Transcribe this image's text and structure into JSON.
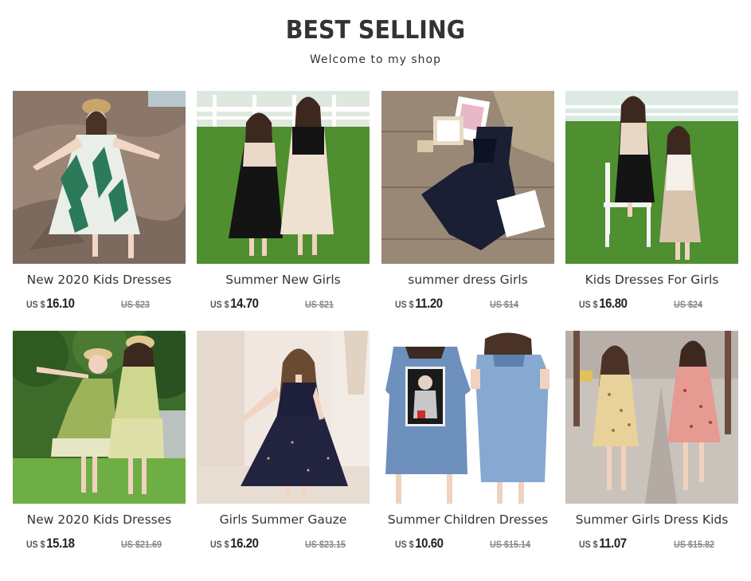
{
  "header": {
    "title": "BEST SELLING",
    "subtitle": "Welcome to my shop"
  },
  "products": [
    {
      "name": "New 2020 Kids Dresses",
      "currency": "US $",
      "price": "16.10",
      "old_price": "US $23",
      "image": "girl-leaf-print-dress-on-rocks"
    },
    {
      "name": "Summer New Girls",
      "currency": "US $",
      "price": "14.70",
      "old_price": "US $21",
      "image": "two-girls-black-and-beige-dresses"
    },
    {
      "name": "summer dress Girls",
      "currency": "US $",
      "price": "11.20",
      "old_price": "US $14",
      "image": "navy-pleated-dress-flatlay"
    },
    {
      "name": "Kids Dresses For Girls",
      "currency": "US $",
      "price": "16.80",
      "old_price": "US $24",
      "image": "two-girls-colorblock-dresses-with-chair"
    },
    {
      "name": "New 2020 Kids Dresses",
      "currency": "US $",
      "price": "15.18",
      "old_price": "US $21.69",
      "image": "two-girls-green-floral-dresses"
    },
    {
      "name": "Girls Summer Gauze",
      "currency": "US $",
      "price": "16.20",
      "old_price": "US $23.15",
      "image": "girl-navy-tulle-dress"
    },
    {
      "name": "Summer Children Dresses",
      "currency": "US $",
      "price": "10.60",
      "old_price": "US $15.14",
      "image": "denim-cold-shoulder-dress"
    },
    {
      "name": "Summer Girls Dress Kids",
      "currency": "US $",
      "price": "11.07",
      "old_price": "US $15.82",
      "image": "two-girls-floral-dresses-in-mall"
    }
  ]
}
